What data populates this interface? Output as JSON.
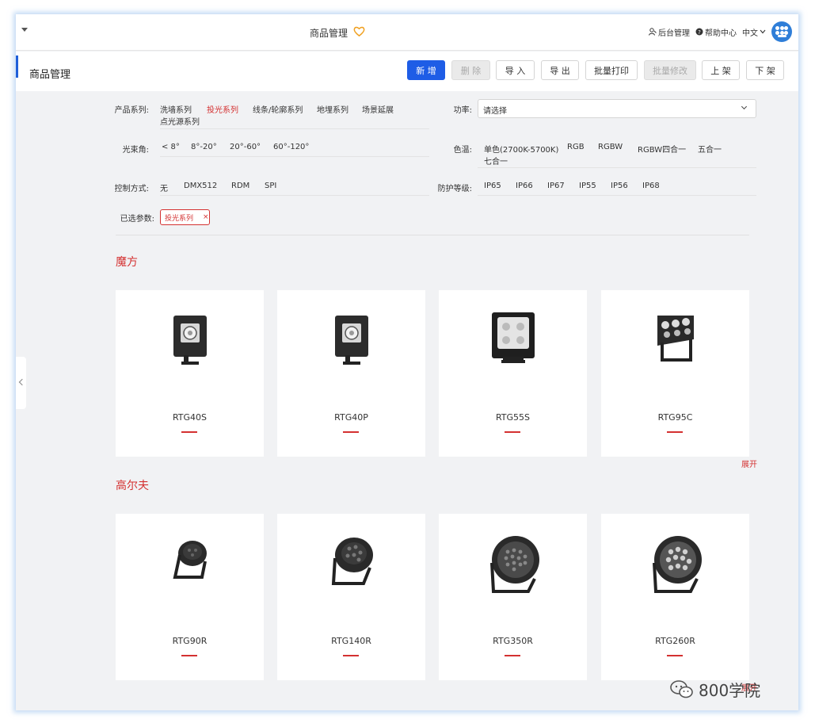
{
  "topbar": {
    "title": "商品管理",
    "admin": "后台管理",
    "help": "帮助中心",
    "language": "中文"
  },
  "header": {
    "page_title": "商品管理",
    "buttons": [
      "新 增",
      "删 除",
      "导 入",
      "导 出",
      "批量打印",
      "批量修改",
      "上 架",
      "下 架"
    ]
  },
  "filters": {
    "series_label": "产品系列:",
    "series_options": [
      "洗墙系列",
      "投光系列",
      "线条/轮廓系列",
      "地埋系列",
      "场景延展",
      "点光源系列"
    ],
    "series_active": "投光系列",
    "power_label": "功率:",
    "power_placeholder": "请选择",
    "beam_label": "光束角:",
    "beam_options": [
      "< 8°",
      "8°-20°",
      "20°-60°",
      "60°-120°"
    ],
    "color_label": "色温:",
    "color_options": [
      "单色(2700K-5700K)",
      "RGB",
      "RGBW",
      "RGBW四合一",
      "五合一",
      "七合一"
    ],
    "control_label": "控制方式:",
    "control_options": [
      "无",
      "DMX512",
      "RDM",
      "SPI"
    ],
    "ip_label": "防护等级:",
    "ip_options": [
      "IP65",
      "IP66",
      "IP67",
      "IP55",
      "IP56",
      "IP68"
    ],
    "selected_label": "已选参数:",
    "selected_tag": "投光系列",
    "remove_symbol": "×"
  },
  "sections": [
    {
      "title": "魔方",
      "products": [
        "RTG40S",
        "RTG40P",
        "RTG55S",
        "RTG95C"
      ],
      "expand": "展开"
    },
    {
      "title": "高尔夫",
      "products": [
        "RTG90R",
        "RTG140R",
        "RTG350R",
        "RTG260R"
      ],
      "expand": "展开"
    }
  ],
  "watermark": "800学院",
  "colors": {
    "accent_red": "#d43131",
    "primary_blue": "#1e5de6",
    "background": "#f1f2f4"
  }
}
